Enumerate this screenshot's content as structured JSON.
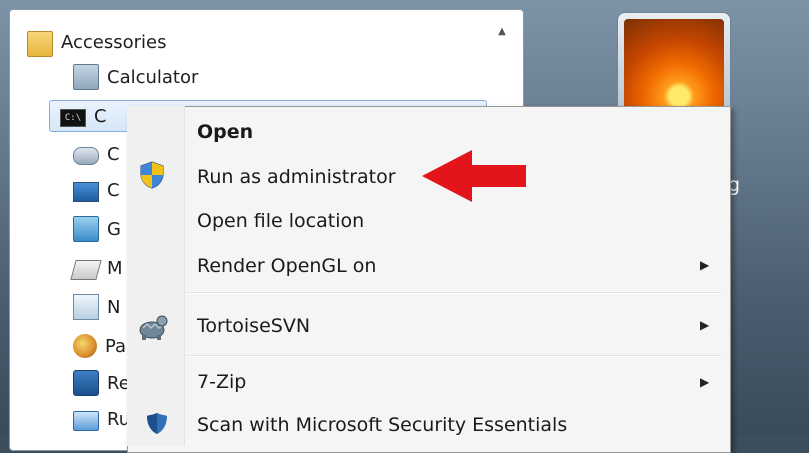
{
  "start_menu": {
    "programs": [
      {
        "label": "Accessories",
        "icon": "folder-icon"
      },
      {
        "label": "Calculator",
        "icon": "calculator-icon"
      },
      {
        "label": "C",
        "icon": "command-prompt-icon"
      },
      {
        "label": "C",
        "icon": "connect-projector-icon"
      },
      {
        "label": "C",
        "icon": "connect-display-icon"
      },
      {
        "label": "G",
        "icon": "getting-started-icon"
      },
      {
        "label": "M",
        "icon": "math-input-icon"
      },
      {
        "label": "N",
        "icon": "notepad-icon"
      },
      {
        "label": "Pa",
        "icon": "paint-icon"
      },
      {
        "label": "Re",
        "icon": "remote-desktop-icon"
      },
      {
        "label": "Ru",
        "icon": "run-icon"
      }
    ]
  },
  "right_pane": {
    "partial_text": "g",
    "user_picture": "flower-user-picture"
  },
  "context_menu": {
    "items": [
      {
        "label": "Open",
        "bold": true
      },
      {
        "label": "Run as administrator",
        "icon": "uac-shield-icon"
      },
      {
        "label": "Open file location"
      },
      {
        "label": "Render OpenGL on",
        "submenu": true
      },
      {
        "label": "TortoiseSVN",
        "icon": "tortoisesvn-icon",
        "submenu": true
      },
      {
        "label": "7-Zip",
        "submenu": true
      },
      {
        "label": "Scan with Microsoft Security Essentials",
        "icon": "security-essentials-icon"
      }
    ],
    "submenu_arrow": "▶"
  },
  "annotation": {
    "arrow_color": "#e3141b"
  }
}
